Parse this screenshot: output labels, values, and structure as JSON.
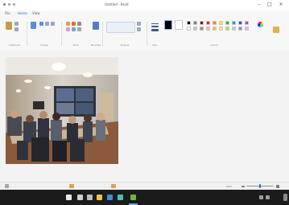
{
  "window": {
    "title": "Untitled - Paint"
  },
  "ribbon": {
    "tabs": [
      "File",
      "Home",
      "View"
    ],
    "groups": [
      "Clipboard",
      "Image",
      "Tools",
      "Brushes",
      "Shapes",
      "Size",
      "Colors"
    ],
    "colors_palette": [
      "#000000",
      "#7f7f7f",
      "#880015",
      "#ed1c24",
      "#ff7f27",
      "#fff200",
      "#22b14c",
      "#00a2e8",
      "#3f48cc",
      "#a349a4",
      "#ffffff",
      "#c3c3c3",
      "#b97a57",
      "#ffaec9",
      "#ffc90e",
      "#efe4b0",
      "#b5e61d",
      "#99d9ea",
      "#7092be",
      "#c8bfe7"
    ]
  },
  "statusbar": {
    "position": "",
    "selection": "",
    "size": "",
    "zoom": "100%"
  },
  "taskbar": {
    "icons": [
      "start-icon",
      "search-icon",
      "task-view-icon",
      "explorer-icon",
      "edge-icon",
      "store-icon",
      "paint-icon"
    ],
    "clock": "",
    "date": ""
  }
}
